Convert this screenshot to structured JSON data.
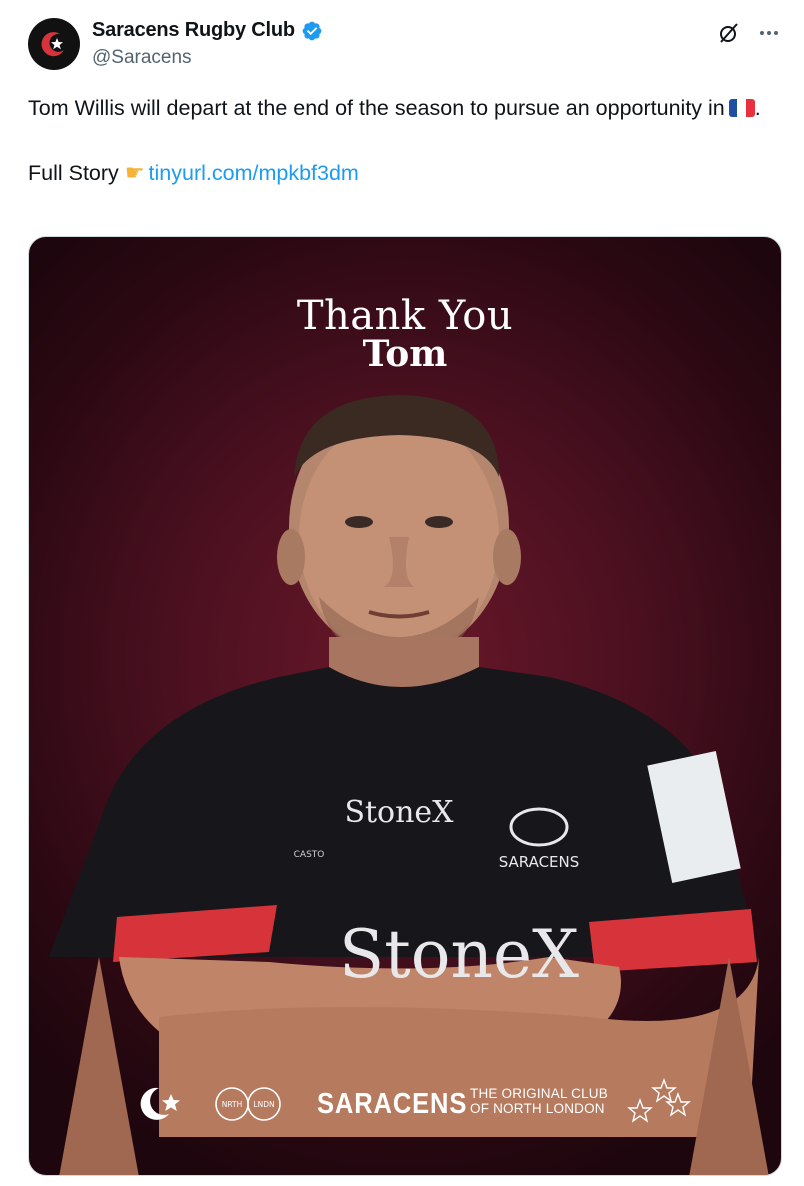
{
  "author": {
    "display_name": "Saracens Rugby Club",
    "handle": "@Saracens",
    "avatar_icon": "saracens-star-crescent-logo",
    "verified_color": "#1d9bf0"
  },
  "header_icons": [
    "grok-icon",
    "more-options-icon"
  ],
  "tweet": {
    "line1": "Tom Willis will depart at the end of the season to pursue an opportunity in",
    "line1_end": ".",
    "flag": "france-flag",
    "full_story_label": "Full Story",
    "pointer_icon": "backhand-index-pointing-right-emoji",
    "link_text": "tinyurl.com/mpkbf3dm",
    "link_color": "#1d9bf0"
  },
  "media": {
    "title_line1": "Thank You",
    "title_line2": "Tom",
    "sponsor_chest": "StoneX",
    "sponsor_sleeve": "StoneX",
    "club_crest_text": "SARACENS",
    "kit_brand": "CASTO",
    "footer": {
      "brand": "SARACENS",
      "tagline_line1": "THE ORIGINAL CLUB",
      "tagline_line2": "OF NORTH LONDON",
      "nl_badge_left": "NRTH",
      "nl_badge_right": "LNDN"
    },
    "background_color": "#4a1020",
    "accent_red": "#d6343a"
  }
}
